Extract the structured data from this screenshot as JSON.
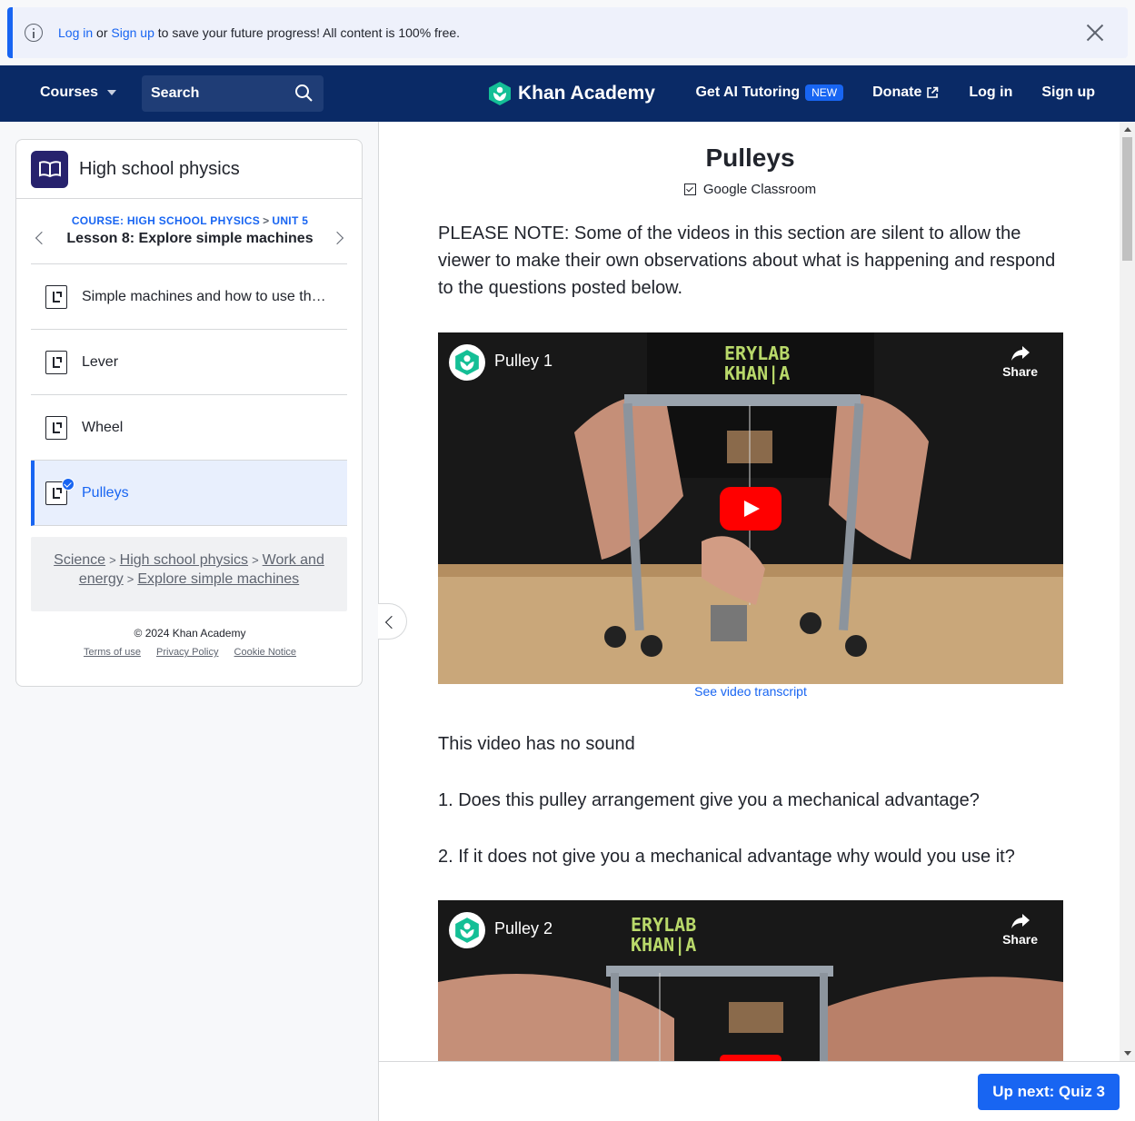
{
  "banner": {
    "login": "Log in",
    "or": "or",
    "signup": "Sign up",
    "message": "to save your future progress! All content is 100% free."
  },
  "header": {
    "courses": "Courses",
    "search_placeholder": "Search",
    "logo": "Khan Academy",
    "ai_tutoring": "Get AI Tutoring",
    "new_badge": "NEW",
    "donate": "Donate",
    "login": "Log in",
    "signup": "Sign up",
    "brand_color": "#0a2a66"
  },
  "sidebar": {
    "title": "High school physics",
    "course_label": "COURSE: HIGH SCHOOL PHYSICS",
    "unit_label": "UNIT 5",
    "lesson": "Lesson 8: Explore simple machines",
    "items": [
      {
        "label": "Simple machines and how to use th…",
        "active": false
      },
      {
        "label": "Lever",
        "active": false
      },
      {
        "label": "Wheel",
        "active": false
      },
      {
        "label": "Pulleys",
        "active": true
      }
    ],
    "breadcrumb": [
      "Science",
      "High school physics",
      "Work and energy",
      "Explore simple machines"
    ],
    "copyright": "© 2024 Khan Academy",
    "legal": [
      "Terms of use",
      "Privacy Policy",
      "Cookie Notice"
    ]
  },
  "main": {
    "title": "Pulleys",
    "google_classroom": "Google Classroom",
    "note": "PLEASE NOTE: Some of the videos in this section are silent to allow the viewer to make their own observations about what is happening and respond to the questions posted below.",
    "video1_title": "Pulley 1",
    "video2_title": "Pulley 2",
    "share": "Share",
    "transcript": "See video transcript",
    "no_sound": "This video has no sound",
    "q1": "1. Does this pulley arrangement give you a mechanical advantage?",
    "q2": "2. If it does not give you a mechanical advantage why would you use it?",
    "up_next": "Up next: Quiz 3"
  }
}
